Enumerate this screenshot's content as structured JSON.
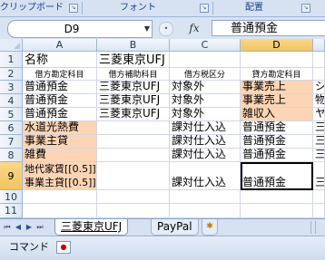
{
  "ribbon": {
    "groups": [
      "クリップボード",
      "フォント",
      "配置"
    ]
  },
  "formula_bar": {
    "name_box": "D9",
    "fx_label": "fx",
    "formula": "普通預金"
  },
  "columns": [
    "A",
    "B",
    "C",
    "D"
  ],
  "rows": [
    "1",
    "2",
    "3",
    "4",
    "5",
    "6",
    "7",
    "8",
    "9",
    "10",
    "11"
  ],
  "cells": {
    "r1": {
      "A": "名称",
      "B": "三菱東京UFJ"
    },
    "r2": {
      "A": "借方勘定科目",
      "B": "借方補助科目",
      "C": "借方税区分",
      "D": "貸方勘定科目"
    },
    "r3": {
      "A": "普通預金",
      "B": "三菱東京UFJ",
      "C": "対象外",
      "D": "事業売上",
      "E": "シ"
    },
    "r4": {
      "A": "普通預金",
      "B": "三菱東京UFJ",
      "C": "対象外",
      "D": "事業売上",
      "E": "物"
    },
    "r5": {
      "A": "普通預金",
      "B": "三菱東京UFJ",
      "C": "対象外",
      "D": "雑収入",
      "E": "ヤ"
    },
    "r6": {
      "A": "水道光熱費",
      "C": "課対仕入込",
      "D": "普通預金",
      "E": "三"
    },
    "r7": {
      "A": "事業主貸",
      "C": "課対仕入込",
      "D": "普通預金",
      "E": "三"
    },
    "r8": {
      "A": "雑費",
      "C": "課対仕入込",
      "D": "普通預金",
      "E": "三"
    },
    "r9": {
      "A1": "地代家賃[[0.5]]",
      "A2": "事業主貸[[0.5]]",
      "C": "課対仕入込",
      "D": "普通預金",
      "E": "三"
    }
  },
  "sheet_tabs": {
    "active": "三菱東京UFJ",
    "other": "PayPal"
  },
  "status_bar": {
    "mode": "コマンド"
  },
  "colors": {
    "highlight": "#fcd5b4",
    "selected_header": "#f3c35f"
  }
}
